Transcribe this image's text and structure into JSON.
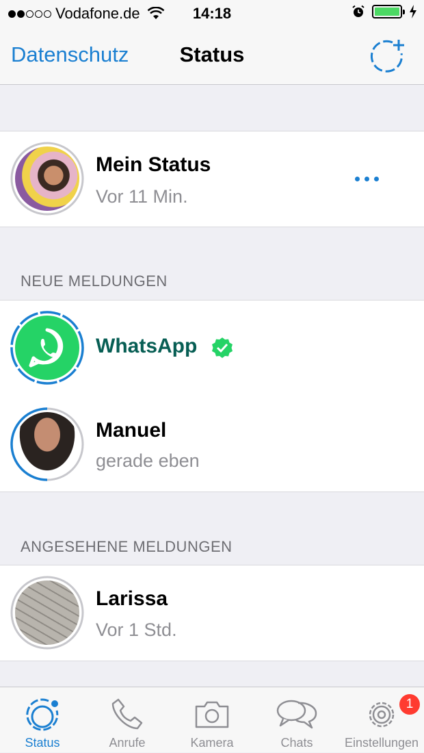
{
  "status_bar": {
    "carrier": "Vodafone.de",
    "time": "14:18"
  },
  "nav": {
    "left_label": "Datenschutz",
    "title": "Status"
  },
  "my_status": {
    "name": "Mein Status",
    "time": "Vor 11 Min."
  },
  "sections": {
    "new_header": "NEUE MELDUNGEN",
    "viewed_header": "ANGESEHENE MELDUNGEN"
  },
  "new_updates": [
    {
      "name": "WhatsApp",
      "verified": true
    },
    {
      "name": "Manuel",
      "time": "gerade eben"
    }
  ],
  "viewed_updates": [
    {
      "name": "Larissa",
      "time": "Vor 1 Std."
    }
  ],
  "tabs": [
    {
      "label": "Status",
      "icon": "status-icon",
      "active": true
    },
    {
      "label": "Anrufe",
      "icon": "phone-icon"
    },
    {
      "label": "Kamera",
      "icon": "camera-icon"
    },
    {
      "label": "Chats",
      "icon": "chats-icon"
    },
    {
      "label": "Einstellungen",
      "icon": "gear-icon",
      "badge": "1"
    }
  ],
  "colors": {
    "accent": "#1a7fd1",
    "whatsapp_green": "#25d366",
    "whatsapp_name": "#075e54",
    "badge": "#ff3b30",
    "battery": "#4cd964"
  }
}
